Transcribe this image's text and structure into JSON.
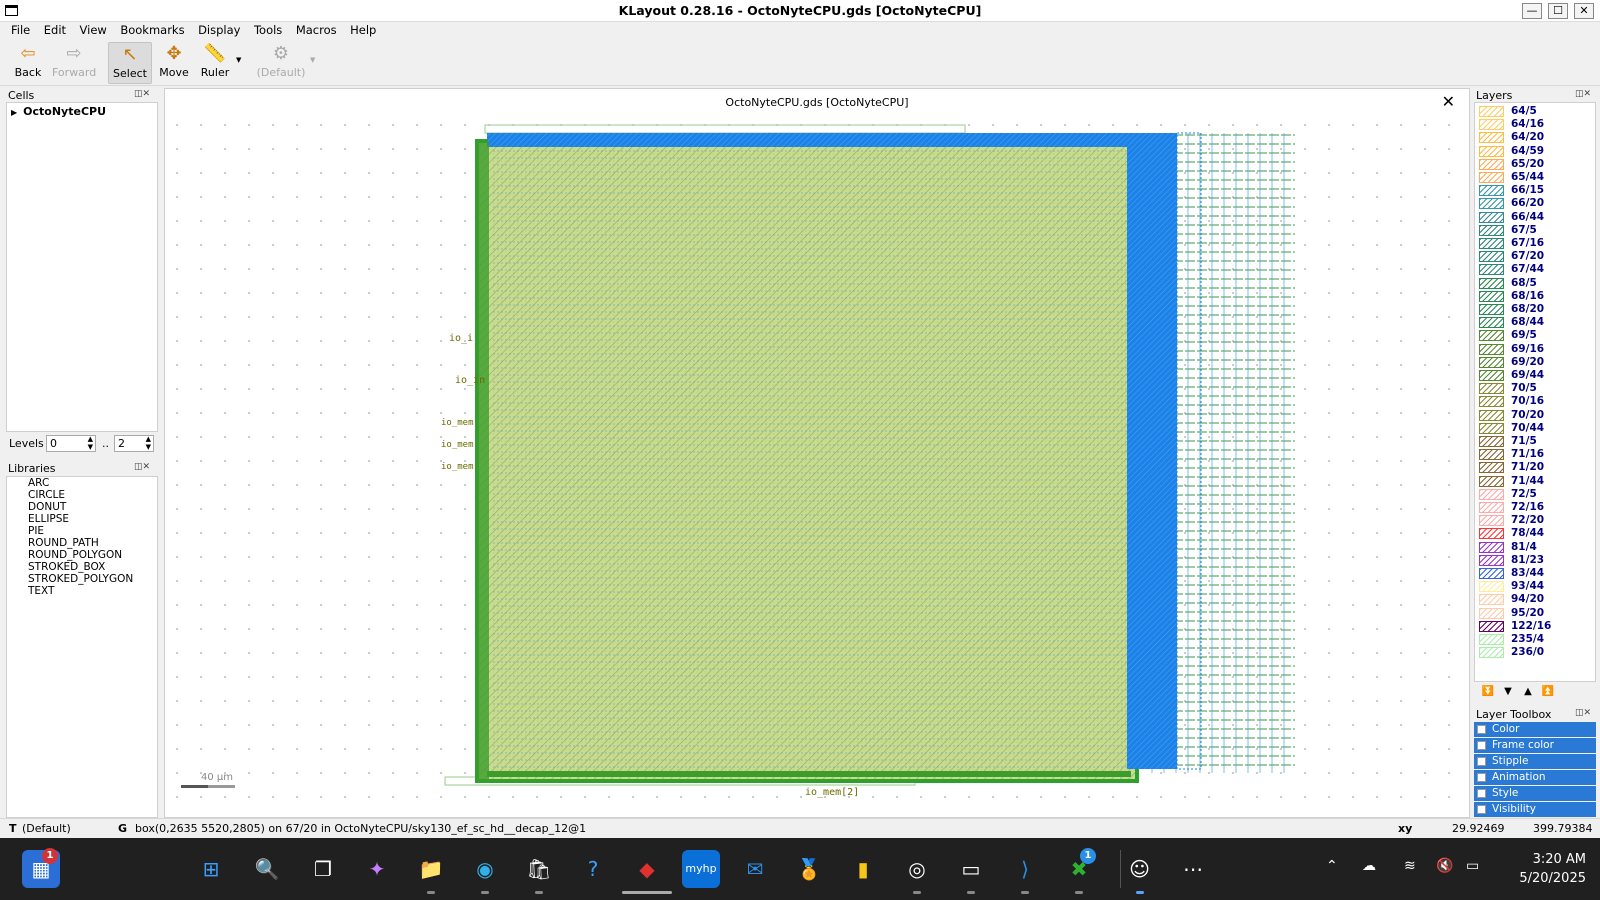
{
  "window": {
    "title": "KLayout 0.28.16 - OctoNyteCPU.gds [OctoNyteCPU]",
    "minimize": "—",
    "maximize": "☐",
    "close": "✕"
  },
  "menu": [
    "File",
    "Edit",
    "View",
    "Bookmarks",
    "Display",
    "Tools",
    "Macros",
    "Help"
  ],
  "toolbar": {
    "back": "Back",
    "forward": "Forward",
    "select": "Select",
    "move": "Move",
    "ruler": "Ruler",
    "default": "(Default)"
  },
  "cells_panel": {
    "title": "Cells",
    "top_cell": "OctoNyteCPU",
    "levels_label": "Levels",
    "level_from": "0",
    "level_to": "2",
    "dots": ".."
  },
  "libraries_panel": {
    "title": "Libraries",
    "items": [
      "ARC",
      "CIRCLE",
      "DONUT",
      "ELLIPSE",
      "PIE",
      "ROUND_PATH",
      "ROUND_POLYGON",
      "STROKED_BOX",
      "STROKED_POLYGON",
      "TEXT"
    ]
  },
  "view": {
    "tab_title": "OctoNyteCPU.gds [OctoNyteCPU]",
    "scale_label": "40 µm",
    "pin_labels": [
      "io_i",
      "io_in",
      "io_mem",
      "io_mem",
      "io_mem",
      "io_mem[2]"
    ]
  },
  "layers_panel": {
    "title": "Layers",
    "layers": [
      {
        "name": "64/5",
        "color": "#ffcc66"
      },
      {
        "name": "64/16",
        "color": "#ffcc66"
      },
      {
        "name": "64/20",
        "color": "#ffbb44"
      },
      {
        "name": "64/59",
        "color": "#ffbb44"
      },
      {
        "name": "65/20",
        "color": "#ffaa55"
      },
      {
        "name": "65/44",
        "color": "#ffaa55"
      },
      {
        "name": "66/15",
        "color": "#3399aa"
      },
      {
        "name": "66/20",
        "color": "#3399aa"
      },
      {
        "name": "66/44",
        "color": "#338899"
      },
      {
        "name": "67/5",
        "color": "#2a8877"
      },
      {
        "name": "67/16",
        "color": "#2a8877"
      },
      {
        "name": "67/20",
        "color": "#2a8877"
      },
      {
        "name": "67/44",
        "color": "#2a8877"
      },
      {
        "name": "68/5",
        "color": "#2a8855"
      },
      {
        "name": "68/16",
        "color": "#2a8855"
      },
      {
        "name": "68/20",
        "color": "#2a8855"
      },
      {
        "name": "68/44",
        "color": "#2a8855"
      },
      {
        "name": "69/5",
        "color": "#558833"
      },
      {
        "name": "69/16",
        "color": "#558833"
      },
      {
        "name": "69/20",
        "color": "#558833"
      },
      {
        "name": "69/44",
        "color": "#558833"
      },
      {
        "name": "70/5",
        "color": "#888833"
      },
      {
        "name": "70/16",
        "color": "#888833"
      },
      {
        "name": "70/20",
        "color": "#888833"
      },
      {
        "name": "70/44",
        "color": "#888833"
      },
      {
        "name": "71/5",
        "color": "#886633"
      },
      {
        "name": "71/16",
        "color": "#886633"
      },
      {
        "name": "71/20",
        "color": "#886633"
      },
      {
        "name": "71/44",
        "color": "#886633"
      },
      {
        "name": "72/5",
        "color": "#ffaaaa"
      },
      {
        "name": "72/16",
        "color": "#ffaaaa"
      },
      {
        "name": "72/20",
        "color": "#ffaaaa"
      },
      {
        "name": "78/44",
        "color": "#ff3333"
      },
      {
        "name": "81/4",
        "color": "#9933cc"
      },
      {
        "name": "81/23",
        "color": "#9933cc"
      },
      {
        "name": "83/44",
        "color": "#3366dd"
      },
      {
        "name": "93/44",
        "color": "#ffee99"
      },
      {
        "name": "94/20",
        "color": "#ffccaa"
      },
      {
        "name": "95/20",
        "color": "#ffccaa"
      },
      {
        "name": "122/16",
        "color": "#660066"
      },
      {
        "name": "235/4",
        "color": "#aaeeaa"
      },
      {
        "name": "236/0",
        "color": "#aaeeaa"
      }
    ]
  },
  "layer_toolbox": {
    "title": "Layer Toolbox",
    "items": [
      "Color",
      "Frame color",
      "Stipple",
      "Animation",
      "Style",
      "Visibility"
    ]
  },
  "status": {
    "mode": "T",
    "mode_value": "(Default)",
    "grid_key": "G",
    "message": "box(0,2635 5520,2805) on 67/20 in OctoNyteCPU/sky130_ef_sc_hd__decap_12@1",
    "coord_key": "xy",
    "x": "29.92469",
    "y": "399.79384"
  },
  "taskbar": {
    "time": "3:20 AM",
    "date": "5/20/2025",
    "app_badge": "1",
    "xbox_badge": "1"
  },
  "colors": {
    "die_fill": "#c5d98a",
    "die_border": "#2da02d",
    "metal_blue": "#1a7fe6",
    "label_olive": "#6b6b00",
    "taskbar": "#202020"
  }
}
